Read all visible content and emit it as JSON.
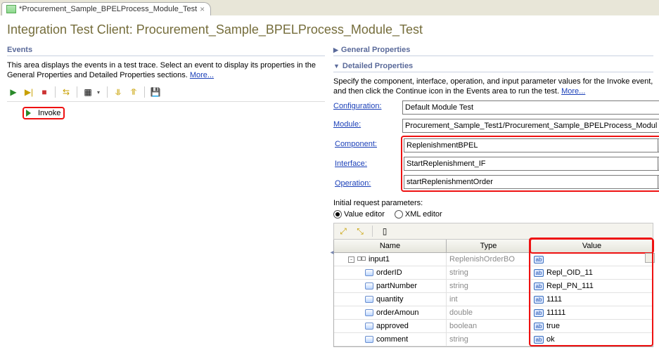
{
  "tab": {
    "title": "*Procurement_Sample_BPELProcess_Module_Test"
  },
  "page_title": "Integration Test Client: Procurement_Sample_BPELProcess_Module_Test",
  "events": {
    "heading": "Events",
    "desc_prefix": "This area displays the events in a test trace. Select an event to display its properties in the General Properties and Detailed Properties sections. ",
    "more": "More...",
    "tree_item": "Invoke"
  },
  "general_properties_heading": "General Properties",
  "detailed": {
    "heading": "Detailed Properties",
    "desc_prefix": "Specify the component, interface, operation, and input parameter values for the Invoke event, and then click the Continue icon in the Events area to run the test. ",
    "more": "More..."
  },
  "form": {
    "configuration": {
      "label": "Configuration:",
      "value": "Default Module Test"
    },
    "module": {
      "label": "Module:",
      "value": "Procurement_Sample_Test1/Procurement_Sample_BPELProcess_Modul"
    },
    "component": {
      "label": "Component:",
      "value": "ReplenishmentBPEL"
    },
    "interface": {
      "label": "Interface:",
      "value": "StartReplenishment_IF"
    },
    "operation": {
      "label": "Operation:",
      "value": "startReplenishmentOrder"
    }
  },
  "req": {
    "heading": "Initial request parameters:",
    "radio_value": "Value editor",
    "radio_xml": "XML editor"
  },
  "table": {
    "headers": {
      "name": "Name",
      "type": "Type",
      "value": "Value"
    },
    "rows": [
      {
        "indent": 1,
        "twist": "-",
        "icon": "struct",
        "name": "input1",
        "type": "ReplenishOrderBO",
        "type_muted": true,
        "value": ""
      },
      {
        "indent": 2,
        "icon": "field",
        "name": "orderID",
        "type": "string",
        "value": "Repl_OID_11"
      },
      {
        "indent": 2,
        "icon": "field",
        "name": "partNumber",
        "type": "string",
        "value": "Repl_PN_111"
      },
      {
        "indent": 2,
        "icon": "field",
        "name": "quantity",
        "type": "int",
        "value": "1111"
      },
      {
        "indent": 2,
        "icon": "field",
        "name": "orderAmoun",
        "type": "double",
        "value": "11111"
      },
      {
        "indent": 2,
        "icon": "field",
        "name": "approved",
        "type": "boolean",
        "value": "true"
      },
      {
        "indent": 2,
        "icon": "field",
        "name": "comment",
        "type": "string",
        "value": "ok"
      }
    ]
  }
}
